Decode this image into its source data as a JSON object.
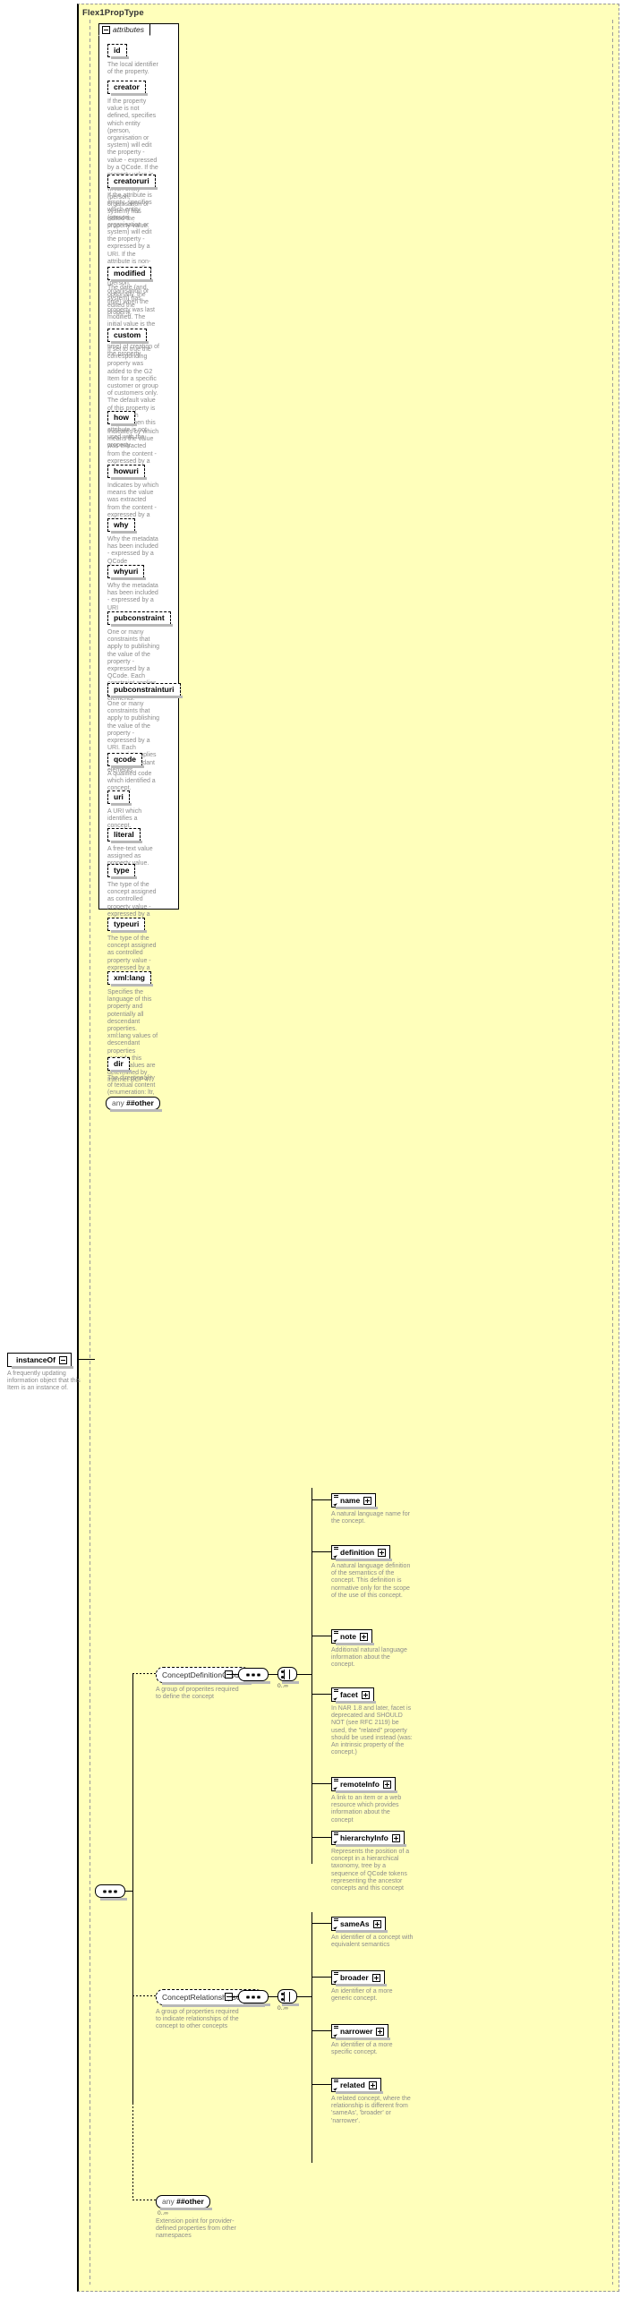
{
  "diagram": {
    "type_name": "Flex1PropType",
    "attributes_tab_label": "attributes",
    "any_other_attr": {
      "label": "any",
      "ns": "##other"
    }
  },
  "attributes": [
    {
      "name": "id",
      "desc": "The local identifier of the property."
    },
    {
      "name": "creator",
      "desc": "If the property value is not defined, specifies which entity (person, organisation or system) will edit the property - value - expressed by a QCode. If the property value is defined, specifies which entity (person, organisation or system) has edited the property value."
    },
    {
      "name": "creatoruri",
      "desc": "If the attribute is empty, specifies which entity (person, organisation or system) will edit the property - expressed by a URI. If the attribute is non-empty, specifies which entity (person, organisation or system) has edited the property."
    },
    {
      "name": "modified",
      "desc": "The date (and, optionally, the time) when the property was last modified. The initial value is the date (and, optionally, the time) of creation of the property."
    },
    {
      "name": "custom",
      "desc": "If set to true the corresponding property was added to the G2 Item for a specific customer or group of customers only. The default value of this property is false which applies when this attribute is not used with the property."
    },
    {
      "name": "how",
      "desc": "Indicates by which means the value was extracted from the content - expressed by a QCode"
    },
    {
      "name": "howuri",
      "desc": "Indicates by which means the value was extracted from the content - expressed by a URI"
    },
    {
      "name": "why",
      "desc": "Why the metadata has been included - expressed by a QCode"
    },
    {
      "name": "whyuri",
      "desc": "Why the metadata has been included - expressed by a URI"
    },
    {
      "name": "pubconstraint",
      "desc": "One or many constraints that apply to publishing the value of the property - expressed by a QCode. Each constraint applies to all descendant elements."
    },
    {
      "name": "pubconstrainturi",
      "desc": "One or many constraints that apply to publishing the value of the property - expressed by a URI. Each constraint applies to all descendant elements."
    },
    {
      "name": "qcode",
      "desc": "A qualified code which identified a concept."
    },
    {
      "name": "uri",
      "desc": "A URI which identifies a concept."
    },
    {
      "name": "literal",
      "desc": "A free-text value assigned as property value."
    },
    {
      "name": "type",
      "desc": "The type of the concept assigned as controlled property value - expressed by a QCode"
    },
    {
      "name": "typeuri",
      "desc": "The type of the concept assigned as controlled property value - expressed by a URI"
    },
    {
      "name": "xml:lang",
      "desc": "Specifies the language of this property and potentially all descendant properties. xml:lang values of descendant properties override this value. Values are determined by Internet BCP 47.",
      "namespaced": true
    },
    {
      "name": "dir",
      "desc": "The directionality of textual content (enumeration: ltr, rtl)"
    }
  ],
  "instance_of": {
    "name": "instanceOf",
    "desc": "A frequently updating information object that this Item is an instance of."
  },
  "groups": [
    {
      "name": "ConceptDefinitionGroup",
      "desc": "A group of properites required to define the concept",
      "cardinality": "0..∞",
      "children": [
        {
          "name": "name",
          "desc": "A natural language name for the concept."
        },
        {
          "name": "definition",
          "desc": "A natural language definition of the semantics of the concept. This definition is normative only for the scope of the use of this concept."
        },
        {
          "name": "note",
          "desc": "Additional natural language information about the concept."
        },
        {
          "name": "facet",
          "desc": "In NAR 1.8 and later, facet is deprecated and SHOULD NOT (see RFC 2119) be used, the \"related\" property should be used instead (was: An intrinsic property of the concept.)"
        },
        {
          "name": "remoteInfo",
          "desc": "A link to an item or a web resource which provides information about the concept"
        },
        {
          "name": "hierarchyInfo",
          "desc": "Represents the position of a concept in a hierarchical taxonomy, tree by a sequence of QCode tokens representing the ancestor concepts and this concept"
        }
      ]
    },
    {
      "name": "ConceptRelationshipsGroup",
      "desc": "A group of properties required to indicate relationships of the concept to other concepts",
      "cardinality": "0..∞",
      "children": [
        {
          "name": "sameAs",
          "desc": "An identifier of a concept with equivalent semantics"
        },
        {
          "name": "broader",
          "desc": "An identifier of a more generic concept."
        },
        {
          "name": "narrower",
          "desc": "An identifier of a more specific concept."
        },
        {
          "name": "related",
          "desc": "A related concept, where the relationship is different from 'sameAs', 'broader' or 'narrower'."
        }
      ]
    }
  ],
  "any_other_element": {
    "label": "any",
    "ns": "##other",
    "cardinality": "0..∞",
    "desc": "Extension point for provider-defined properties from other namespaces"
  },
  "colors": {
    "type_background": "#ffffbb",
    "box_background": "#ffffff",
    "line": "#000000",
    "description_text": "#8c8c8c",
    "shadow": "#b8b8b8"
  }
}
